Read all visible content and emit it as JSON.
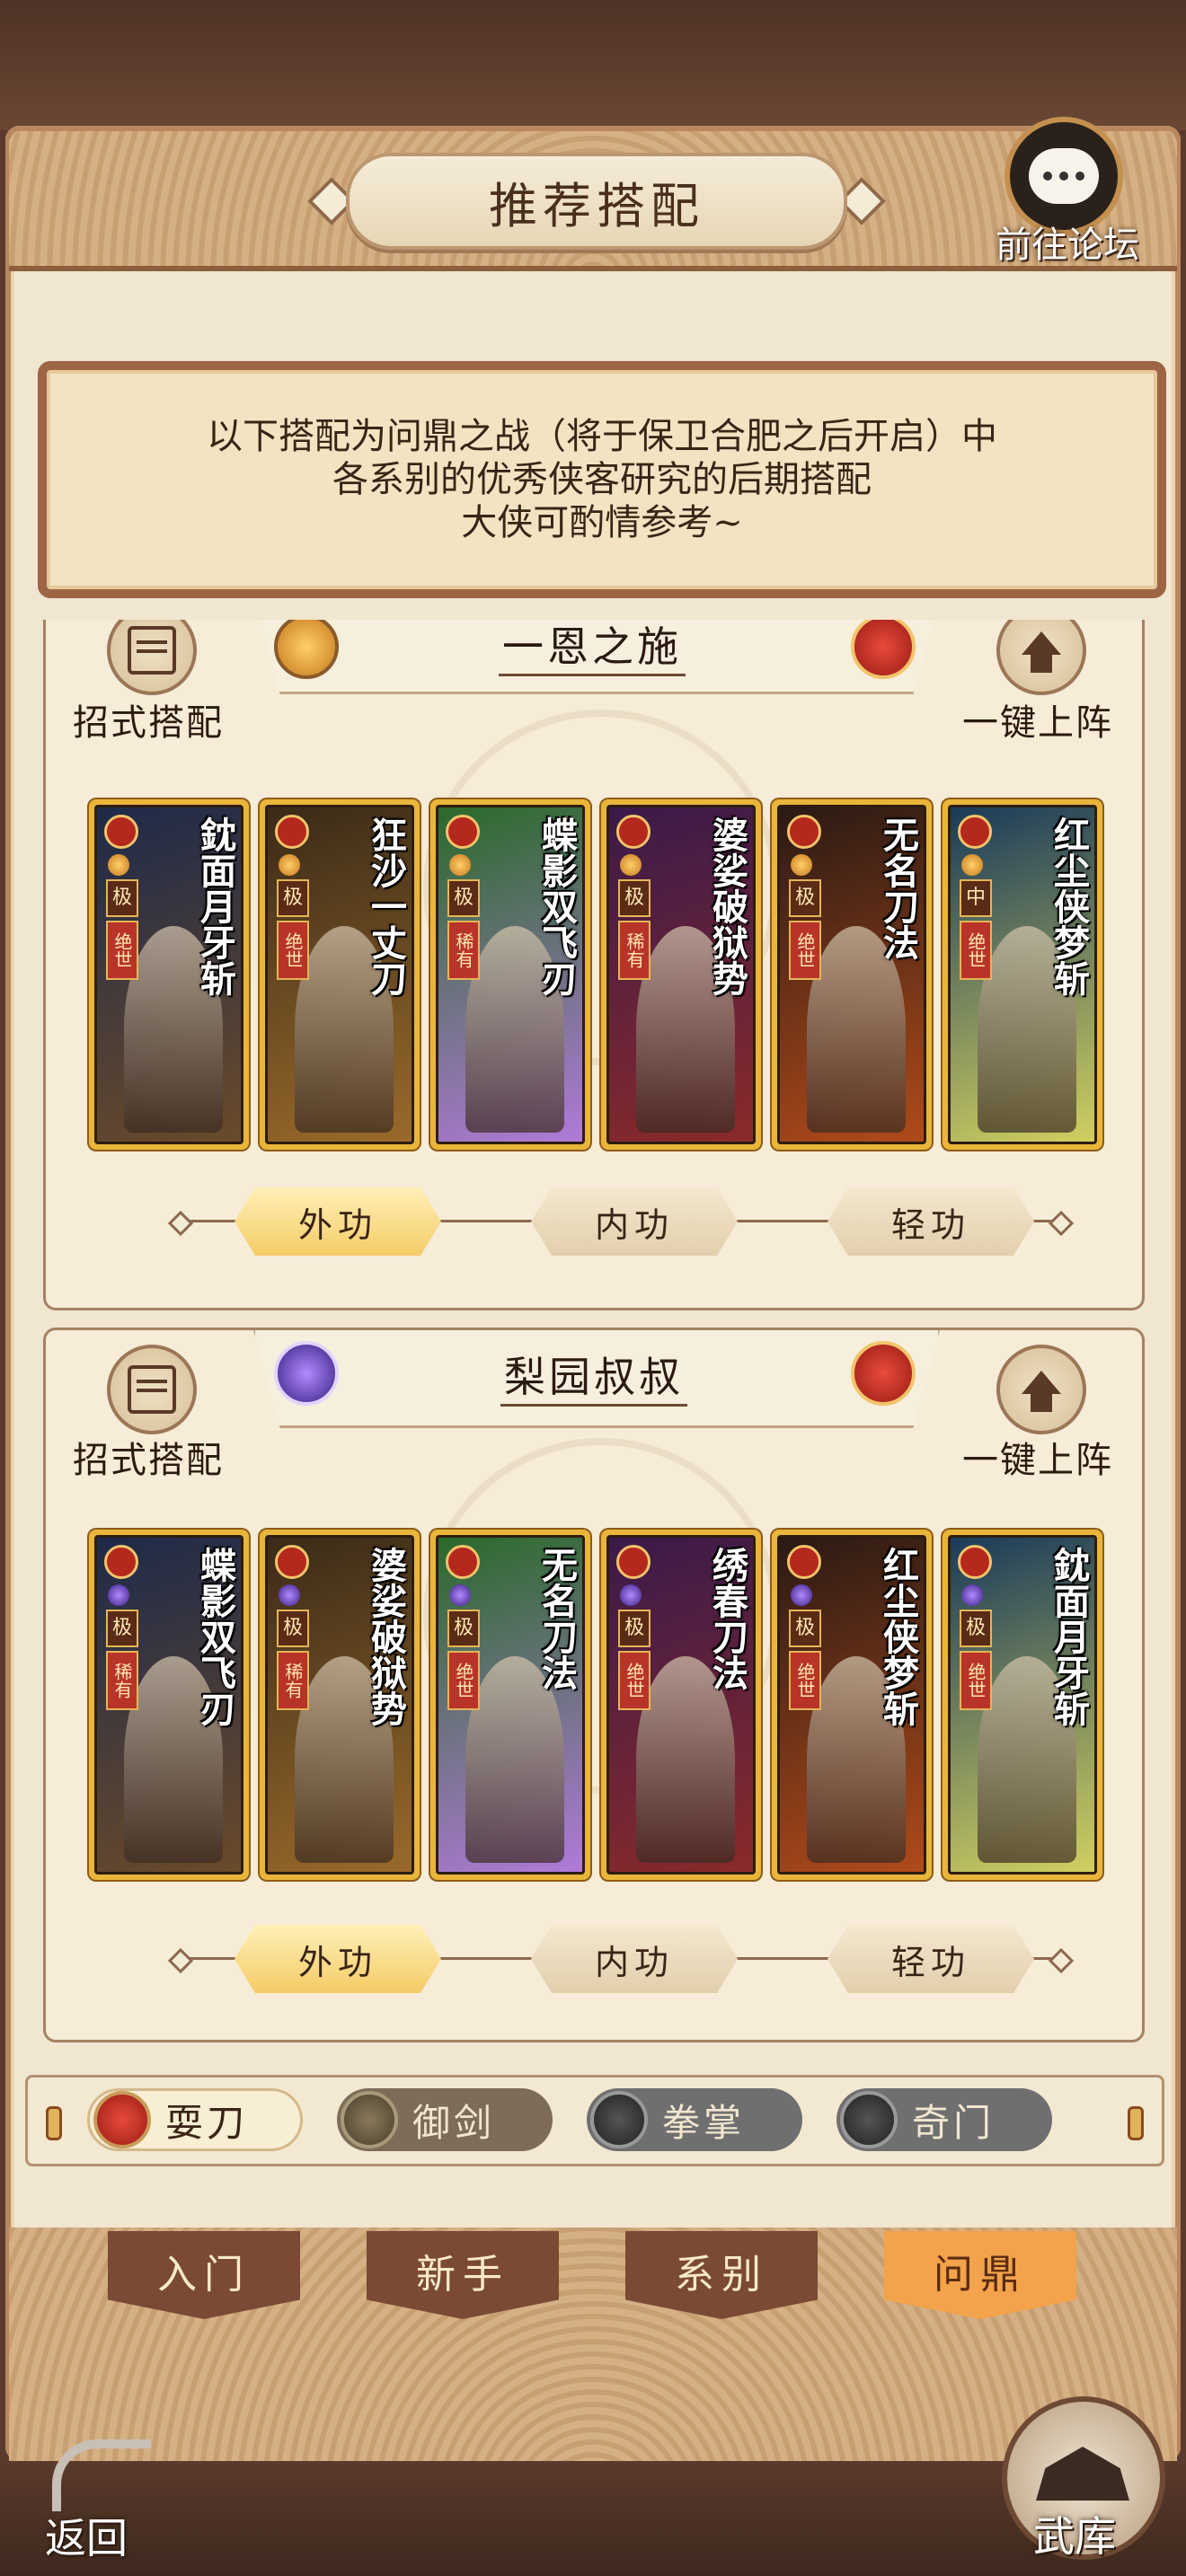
{
  "header": {
    "title": "推荐搭配",
    "forum_label": "前往论坛"
  },
  "notice": {
    "lines": [
      "以下搭配为问鼎之战（将于保卫合肥之后开启）中",
      "各系别的优秀侠客研究的后期搭配",
      "大侠可酌情参考~"
    ]
  },
  "teams": [
    {
      "name": "一恩之施",
      "left_label": "招式搭配",
      "right_label": "一键上阵",
      "cards": [
        {
          "title": "鈂面月牙斩",
          "grade": "极",
          "rarity": "绝世"
        },
        {
          "title": "狂沙一丈刀",
          "grade": "极",
          "rarity": "绝世"
        },
        {
          "title": "蝶影双飞刃",
          "grade": "极",
          "rarity": "稀有"
        },
        {
          "title": "婆娑破狱势",
          "grade": "极",
          "rarity": "稀有"
        },
        {
          "title": "无名刀法",
          "grade": "极",
          "rarity": "绝世"
        },
        {
          "title": "红尘侠梦斩",
          "grade": "中",
          "rarity": "绝世"
        }
      ],
      "slots": [
        "外功",
        "内功",
        "轻功"
      ]
    },
    {
      "name": "梨园叔叔",
      "left_label": "招式搭配",
      "right_label": "一键上阵",
      "cards": [
        {
          "title": "蝶影双飞刃",
          "grade": "极",
          "rarity": "稀有"
        },
        {
          "title": "婆娑破狱势",
          "grade": "极",
          "rarity": "稀有"
        },
        {
          "title": "无名刀法",
          "grade": "极",
          "rarity": "绝世"
        },
        {
          "title": "绣春刀法",
          "grade": "极",
          "rarity": "绝世"
        },
        {
          "title": "红尘侠梦斩",
          "grade": "极",
          "rarity": "绝世"
        },
        {
          "title": "鈂面月牙斩",
          "grade": "极",
          "rarity": "绝世"
        }
      ],
      "slots": [
        "外功",
        "内功",
        "轻功"
      ]
    }
  ],
  "sects": [
    {
      "label": "耍刀",
      "active": true,
      "icon": "blade-icon"
    },
    {
      "label": "御剑",
      "active": false,
      "icon": "sword-icon"
    },
    {
      "label": "拳掌",
      "active": false,
      "icon": "fist-icon"
    },
    {
      "label": "奇门",
      "active": false,
      "icon": "fan-icon"
    }
  ],
  "nav_tabs": [
    {
      "label": "入门",
      "active": false
    },
    {
      "label": "新手",
      "active": false
    },
    {
      "label": "系别",
      "active": false
    },
    {
      "label": "问鼎",
      "active": true
    }
  ],
  "footer": {
    "back_label": "返回",
    "armory_label": "武库"
  },
  "colors": {
    "accent_gold": "#e9b53a",
    "active_tab": "#f2a34b",
    "frame_brown": "#9d6544"
  }
}
